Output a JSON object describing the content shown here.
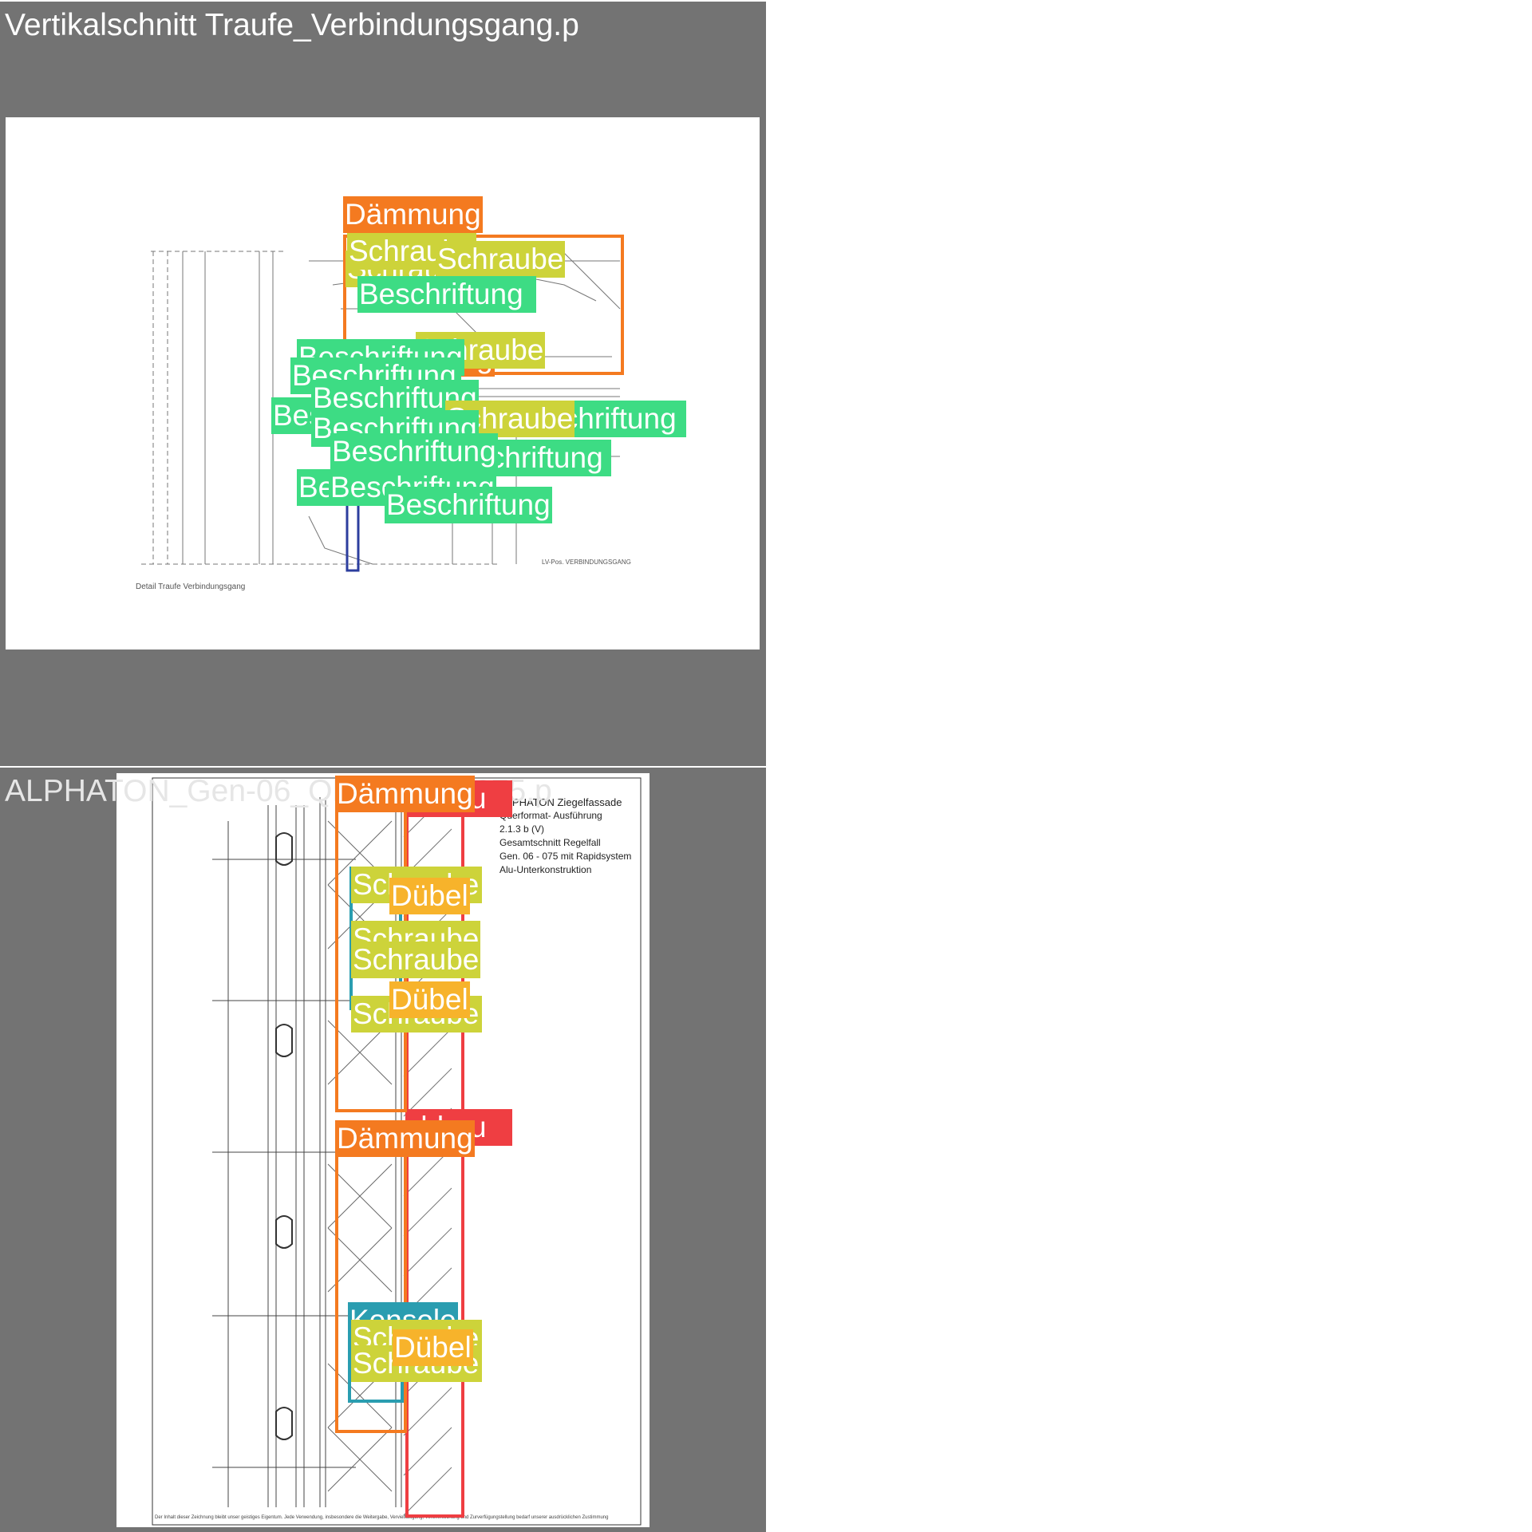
{
  "panels": [
    {
      "title": "Vertikalschnitt Traufe_Verbindungsgang.p",
      "captions": {
        "detail": "Detail Traufe Verbindungsgang",
        "lv": "LV-Pos. VERBINDUNGSGANG"
      },
      "labels": {
        "daemmung": "Dämmung",
        "schraube": "Schraube",
        "beschriftung": "Beschriftung"
      }
    },
    {
      "title": "ALPHATON_Gen-06_QF_Schnitt-075.p",
      "sheet_text": {
        "line1": "ALPHATON  Ziegelfassade",
        "line2": "Querformat- Ausführung",
        "line3": "2.1.3 b      (V)",
        "line4": "Gesamtschnitt       Regelfall",
        "line5": "Gen. 06 - 075 mit Rapidsystem",
        "line6": "Alu-Unterkonstruktion",
        "footer": "Der Inhalt dieser Zeichnung bleibt unser geistiges Eigentum. Jede Verwendung, insbesondere die Weitergabe, Vervielfältigung, Veröffentlichung und Zurverfügungstellung bedarf unserer ausdrücklichen Zustimmung"
      },
      "labels": {
        "daemmung": "Dämmung",
        "rohbau": "Rohbau",
        "schraube": "Schraube",
        "duebel": "Dübel",
        "konsole": "Konsole"
      }
    }
  ],
  "colors": {
    "daemmung": "#f47a20",
    "schraube": "#cdd33a",
    "beschriftung": "#3ddc84",
    "rohbau": "#ef3e42",
    "konsole": "#2a9db0",
    "duebel": "#f7b32b"
  }
}
